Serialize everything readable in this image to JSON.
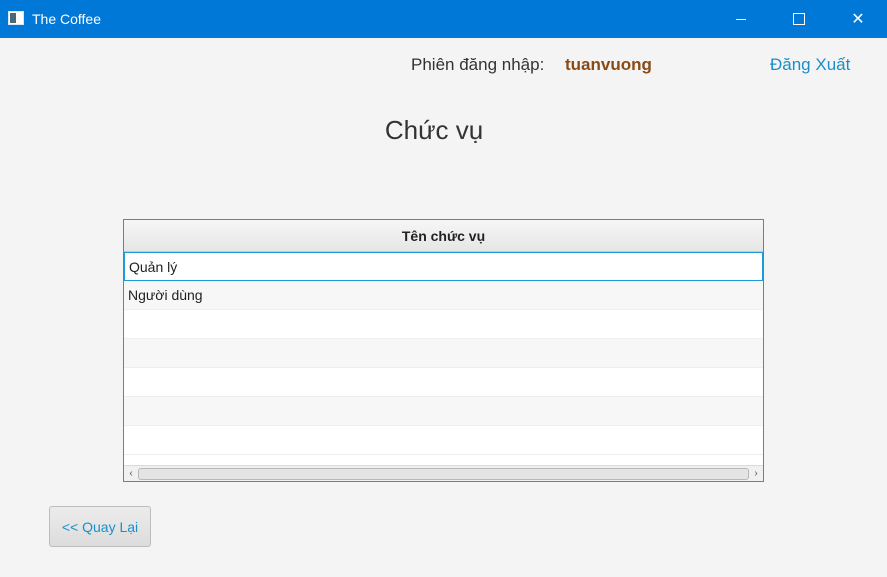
{
  "window": {
    "title": "The Coffee",
    "icons": {
      "app": "app-icon",
      "minimize": "minimize-icon",
      "maximize": "maximize-icon",
      "close": "close-icon"
    }
  },
  "header": {
    "session_label": "Phiên đăng nhập:",
    "username": "tuanvuong",
    "logout_label": "Đăng Xuất"
  },
  "page": {
    "title": "Chức vụ"
  },
  "table": {
    "column_header": "Tên chức vụ",
    "rows": [
      "Quản lý",
      "Người dùng",
      "",
      "",
      "",
      "",
      ""
    ],
    "selected_row": 0
  },
  "scrollbar": {
    "left_arrow": "‹",
    "right_arrow": "›"
  },
  "footer": {
    "back_label": "<< Quay Lại"
  },
  "colors": {
    "titlebar": "#0078d7",
    "accent": "#1e9ad6",
    "link": "#1a8fc8",
    "username": "#8a4a15"
  }
}
